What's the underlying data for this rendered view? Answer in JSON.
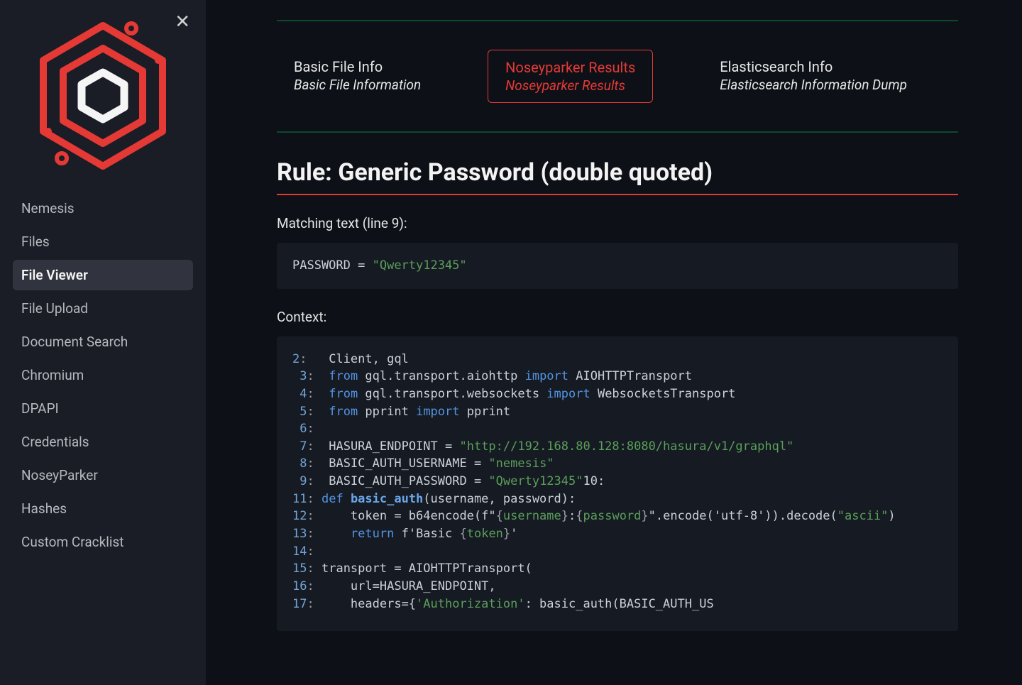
{
  "sidebar": {
    "items": [
      {
        "label": "Nemesis",
        "active": false
      },
      {
        "label": "Files",
        "active": false
      },
      {
        "label": "File Viewer",
        "active": true
      },
      {
        "label": "File Upload",
        "active": false
      },
      {
        "label": "Document Search",
        "active": false
      },
      {
        "label": "Chromium",
        "active": false
      },
      {
        "label": "DPAPI",
        "active": false
      },
      {
        "label": "Credentials",
        "active": false
      },
      {
        "label": "NoseyParker",
        "active": false
      },
      {
        "label": "Hashes",
        "active": false
      },
      {
        "label": "Custom Cracklist",
        "active": false
      }
    ]
  },
  "tabs": [
    {
      "title": "Basic File Info",
      "sub": "Basic File Information",
      "active": false
    },
    {
      "title": "Noseyparker Results",
      "sub": "Noseyparker Results",
      "active": true
    },
    {
      "title": "Elasticsearch Info",
      "sub": "Elasticsearch Information Dump",
      "active": false
    }
  ],
  "rule": {
    "title": "Rule: Generic Password (double quoted)",
    "match_label": "Matching text (line 9):",
    "match_var": "PASSWORD",
    "match_eq": " = ",
    "match_val": "\"Qwerty12345\"",
    "context_label": "Context:",
    "lines": {
      "l2": {
        "n": "2",
        "pre": "   Client, gql"
      },
      "l3": {
        "n": "3",
        "kw1": "from",
        "mid": " gql.transport.aiohttp ",
        "kw2": "import",
        "post": " AIOHTTPTransport"
      },
      "l4": {
        "n": "4",
        "kw1": "from",
        "mid": " gql.transport.websockets ",
        "kw2": "import",
        "post": " WebsocketsTransport"
      },
      "l5": {
        "n": "5",
        "kw1": "from",
        "mid": " pprint ",
        "kw2": "import",
        "post": " pprint"
      },
      "l6": {
        "n": "6",
        "text": ""
      },
      "l7": {
        "n": "7",
        "var": "HASURA_ENDPOINT",
        "eq": " = ",
        "str": "\"http://192.168.80.128:8080/hasura/v1/graphql\""
      },
      "l8": {
        "n": "8",
        "var": "BASIC_AUTH_USERNAME",
        "eq": " = ",
        "str": "\"nemesis\""
      },
      "l9": {
        "n": "9",
        "var": "BASIC_AUTH_PASSWORD",
        "eq": " = ",
        "str": "\"Qwerty12345\"",
        "tail": "10:"
      },
      "l11": {
        "n": "11",
        "kw": "def ",
        "fn": "basic_auth",
        "rest": "(username, password):"
      },
      "l12": {
        "n": "12",
        "pre": "    token = b64encode(f\"",
        "s1": "{",
        "v1": "username",
        "s2": "}",
        "mid": ":",
        "s3": "{",
        "v2": "password",
        "s4": "}",
        "post": "\".encode('utf-8')).decode(",
        "str": "\"ascii\"",
        "end": ")"
      },
      "l13": {
        "n": "13",
        "indent": "    ",
        "kw": "return",
        "rest": " f'Basic ",
        "s1": "{",
        "v1": "token",
        "s2": "}",
        "end": "'"
      },
      "l14": {
        "n": "14",
        "text": ""
      },
      "l15": {
        "n": "15",
        "text": "transport = AIOHTTPTransport("
      },
      "l16": {
        "n": "16",
        "text": "    url=HASURA_ENDPOINT,"
      },
      "l17": {
        "n": "17",
        "pre": "    headers={",
        "str": "'Authorization'",
        "rest": ": basic_auth(BASIC_AUTH_US"
      }
    }
  }
}
